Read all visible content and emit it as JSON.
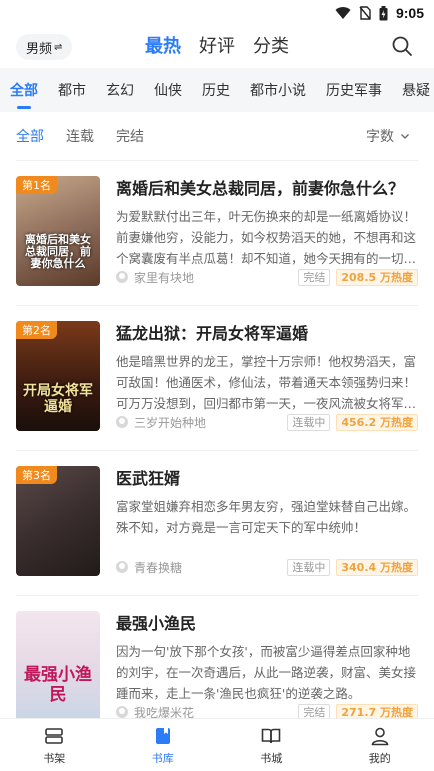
{
  "status_bar": {
    "time": "9:05"
  },
  "header": {
    "gender_label": "男频",
    "gender_arrow": "⇌",
    "tabs": [
      {
        "label": "最热",
        "active": true
      },
      {
        "label": "好评",
        "active": false
      },
      {
        "label": "分类",
        "active": false
      }
    ]
  },
  "categories": [
    "全部",
    "都市",
    "玄幻",
    "仙侠",
    "历史",
    "都市小说",
    "历史军事",
    "悬疑"
  ],
  "filters": {
    "items": [
      "全部",
      "连载",
      "完结"
    ],
    "sort_label": "字数"
  },
  "books": [
    {
      "rank": "第1名",
      "title": "离婚后和美女总裁同居，前妻你急什么？",
      "desc": "为爱默默付出三年，叶无伤换来的却是一纸离婚协议！前妻嫌他穷，没能力，如今权势滔天的她，不想再和这个窝囊废有半点瓜葛！却不知道，她今天拥有的一切…",
      "author": "家里有块地",
      "status": "完结",
      "heat": "208.5 万热度",
      "cover_title": "离婚后和美女总裁同居，前妻你急什么",
      "cover_colors": [
        "#c9a98a",
        "#5b3a2a"
      ]
    },
    {
      "rank": "第2名",
      "title": "猛龙出狱：开局女将军逼婚",
      "desc": "他是暗黑世界的龙王，掌控十万宗师！他权势滔天，富可敌国！他通医术，修仙法，带着通天本领强势归来！可万万没想到，回归都市第一天，一夜风流被女将军…",
      "author": "三岁开始种地",
      "status": "连载中",
      "heat": "456.2 万热度",
      "cover_title": "开局女将军逼婚",
      "cover_colors": [
        "#7a3a1a",
        "#1a0f0a"
      ]
    },
    {
      "rank": "第3名",
      "title": "医武狂婿",
      "desc": "富家堂姐嫌弃相恋多年男友穷，强迫堂妹替自己出嫁。殊不知，对方竟是一言可定天下的军中统帅！",
      "author": "青春换糖",
      "status": "连载中",
      "heat": "340.4 万热度",
      "cover_title": "",
      "cover_colors": [
        "#5a4a48",
        "#221a1a"
      ]
    },
    {
      "rank": "",
      "title": "最强小渔民",
      "desc": "因为一句'放下那个女孩'，而被富少逼得差点回家种地的刘宇，在一次奇遇后，从此一路逆袭，财富、美女接踵而来，走上一条'渔民也疯狂'的逆袭之路。",
      "author": "我吃爆米花",
      "status": "完结",
      "heat": "271.7 万热度",
      "cover_title": "最强小渔民",
      "cover_colors": [
        "#f3e6ee",
        "#c9d6e6"
      ]
    }
  ],
  "tabbar": [
    {
      "label": "书架",
      "icon": "bookshelf-icon",
      "active": false
    },
    {
      "label": "书库",
      "icon": "library-icon",
      "active": true
    },
    {
      "label": "书城",
      "icon": "bookstore-icon",
      "active": false
    },
    {
      "label": "我的",
      "icon": "profile-icon",
      "active": false
    }
  ],
  "colors": {
    "accent": "#2b7cf6",
    "rank_badge": "#f08a1c",
    "heat": "#f0a23c"
  }
}
